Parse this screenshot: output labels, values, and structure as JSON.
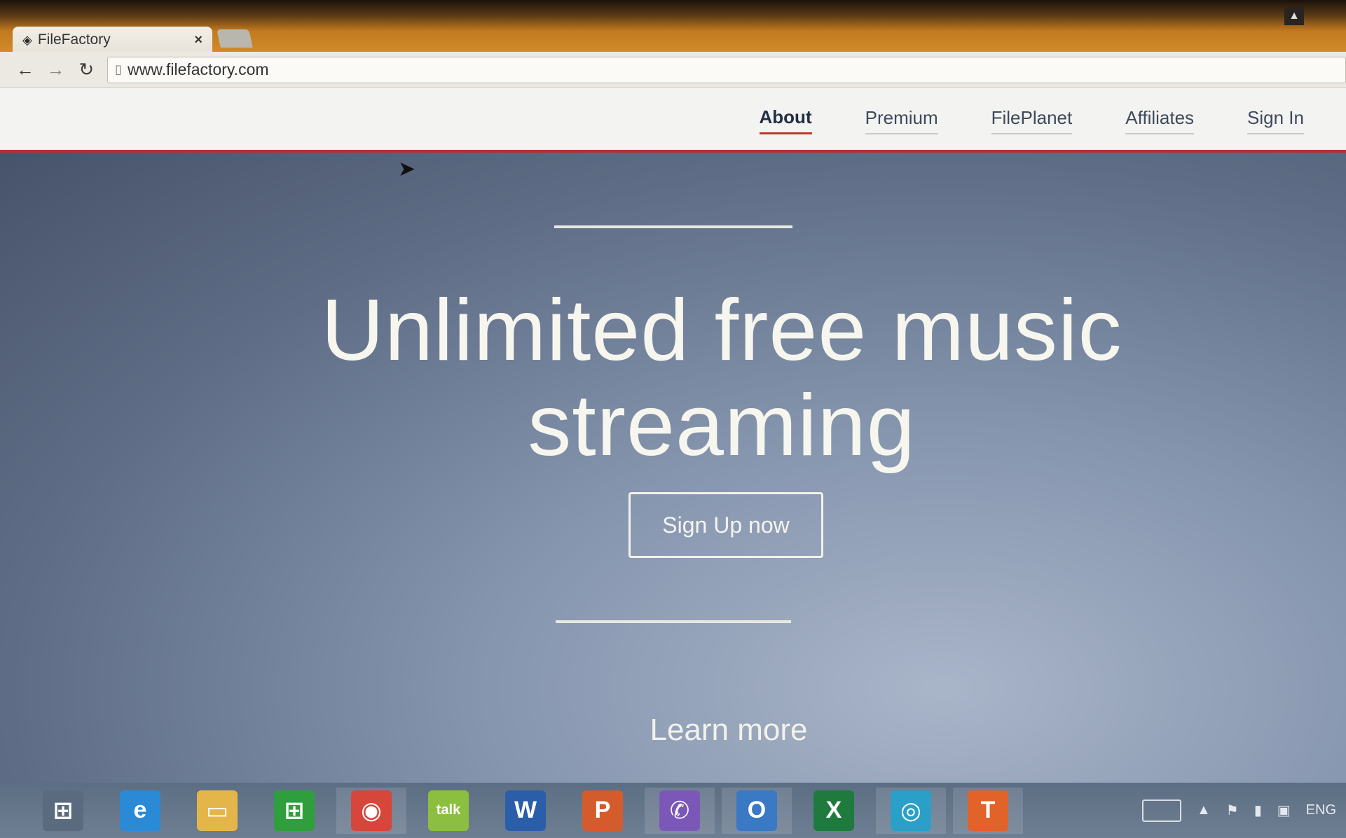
{
  "browser": {
    "tab_title": "FileFactory",
    "tab_close": "×",
    "url": "www.filefactory.com",
    "back_icon": "←",
    "forward_icon": "→",
    "reload_icon": "↻"
  },
  "nav": {
    "items": [
      {
        "label": "About",
        "active": true
      },
      {
        "label": "Premium"
      },
      {
        "label": "FilePlanet"
      },
      {
        "label": "Affiliates"
      },
      {
        "label": "Sign In"
      }
    ]
  },
  "hero": {
    "headline": "Unlimited free music streaming",
    "cta": "Sign Up now",
    "learn_more": "Learn more"
  },
  "taskbar": {
    "apps": [
      {
        "name": "windows-start-icon",
        "glyph": "⊞",
        "color": "#5a6b80"
      },
      {
        "name": "internet-explorer-icon",
        "glyph": "e",
        "color": "#2a8ad6"
      },
      {
        "name": "file-explorer-icon",
        "glyph": "▭",
        "color": "#e4b64a"
      },
      {
        "name": "store-icon",
        "glyph": "⊞",
        "color": "#2f9e3d"
      },
      {
        "name": "chrome-icon",
        "glyph": "◉",
        "color": "#d6463a"
      },
      {
        "name": "google-talk-icon",
        "glyph": "talk",
        "color": "#8cbf3f"
      },
      {
        "name": "word-icon",
        "glyph": "W",
        "color": "#2b5ea8"
      },
      {
        "name": "powerpoint-icon",
        "glyph": "P",
        "color": "#d45c2c"
      },
      {
        "name": "viber-icon",
        "glyph": "✆",
        "color": "#7b58b8"
      },
      {
        "name": "outlook-icon",
        "glyph": "O",
        "color": "#3a79c4"
      },
      {
        "name": "excel-icon",
        "glyph": "X",
        "color": "#1f7a3e"
      },
      {
        "name": "media-player-icon",
        "glyph": "◎",
        "color": "#2aa0c8"
      },
      {
        "name": "t-app-icon",
        "glyph": "T",
        "color": "#e2632a"
      }
    ],
    "tray_lang": "ENG"
  }
}
